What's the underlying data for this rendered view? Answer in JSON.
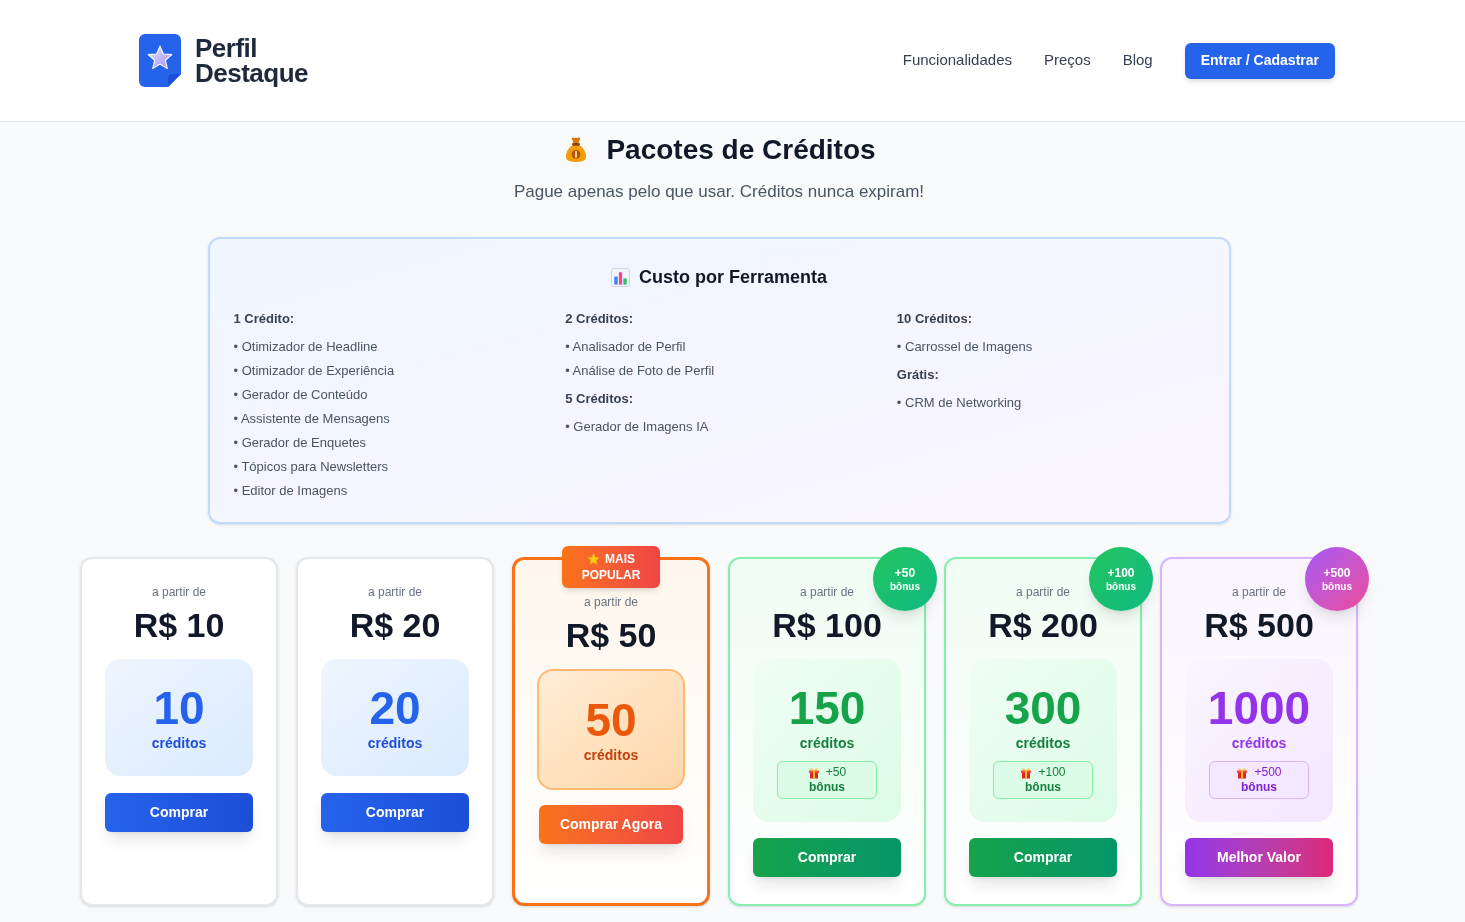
{
  "header": {
    "brand": [
      "Perfil",
      "Destaque"
    ],
    "nav": [
      {
        "label": "Funcionalidades"
      },
      {
        "label": "Preços"
      },
      {
        "label": "Blog"
      }
    ],
    "cta": "Entrar / Cadastrar"
  },
  "page": {
    "title": "Pacotes de Créditos",
    "subtitle": "Pague apenas pelo que usar. Créditos nunca expiram!"
  },
  "cost_table": {
    "title": "Custo por Ferramenta",
    "columns": [
      {
        "groups": [
          {
            "heading": "1 Crédito:",
            "items": [
              "• Otimizador de Headline",
              "• Otimizador de Experiência",
              "• Gerador de Conteúdo",
              "• Assistente de Mensagens",
              "• Gerador de Enquetes",
              "• Tópicos para Newsletters",
              "• Editor de Imagens"
            ]
          }
        ]
      },
      {
        "groups": [
          {
            "heading": "2 Créditos:",
            "items": [
              "• Analisador de Perfil",
              "• Análise de Foto de Perfil"
            ]
          },
          {
            "heading": "5 Créditos:",
            "items": [
              "• Gerador de Imagens IA"
            ]
          }
        ]
      },
      {
        "groups": [
          {
            "heading": "10 Créditos:",
            "items": [
              "• Carrossel de Imagens"
            ]
          },
          {
            "heading": "Grátis:",
            "items": [
              "• CRM de Networking"
            ]
          }
        ]
      }
    ]
  },
  "packages": [
    {
      "kind": "basic",
      "from_label": "a partir de",
      "price": "R$ 10",
      "credits": "10",
      "credits_label": "créditos",
      "button": "Comprar"
    },
    {
      "kind": "basic",
      "from_label": "a partir de",
      "price": "R$ 20",
      "credits": "20",
      "credits_label": "créditos",
      "button": "Comprar"
    },
    {
      "kind": "popular",
      "ribbon": [
        "MAIS",
        "POPULAR"
      ],
      "from_label": "a partir de",
      "price": "R$ 50",
      "credits": "50",
      "credits_label": "créditos",
      "button": "Comprar Agora"
    },
    {
      "kind": "bonus",
      "badge": {
        "amount": "+50",
        "label": "bônus"
      },
      "from_label": "a partir de",
      "price": "R$ 100",
      "credits": "150",
      "credits_label": "créditos",
      "bonus_tag": {
        "amount": "+50",
        "label": "bônus"
      },
      "button": "Comprar"
    },
    {
      "kind": "bonus",
      "badge": {
        "amount": "+100",
        "label": "bônus"
      },
      "from_label": "a partir de",
      "price": "R$ 200",
      "credits": "300",
      "credits_label": "créditos",
      "bonus_tag": {
        "amount": "+100",
        "label": "bônus"
      },
      "button": "Comprar"
    },
    {
      "kind": "best_value",
      "badge": {
        "amount": "+500",
        "label": "bônus"
      },
      "from_label": "a partir de",
      "price": "R$ 500",
      "credits": "1000",
      "credits_label": "créditos",
      "bonus_tag": {
        "amount": "+500",
        "label": "bônus"
      },
      "button": "Melhor Valor"
    }
  ]
}
